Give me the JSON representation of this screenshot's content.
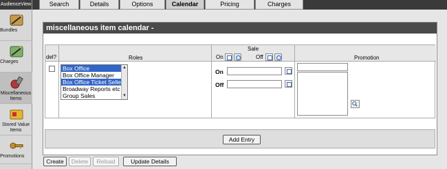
{
  "app": {
    "brand": "AudienceView"
  },
  "sidebar": {
    "items": [
      {
        "label": "Bundles",
        "icon": "bundles-icon"
      },
      {
        "label": "Charges",
        "icon": "charges-icon"
      },
      {
        "label": "Miscellaneous Items",
        "icon": "misc-items-icon",
        "active": true
      },
      {
        "label": "Stored Value Items",
        "icon": "stored-value-icon"
      },
      {
        "label": "Promotions",
        "icon": "promotions-icon"
      }
    ]
  },
  "tabs": [
    {
      "label": "Search"
    },
    {
      "label": "Details"
    },
    {
      "label": "Options"
    },
    {
      "label": "Calendar",
      "active": true
    },
    {
      "label": "Pricing"
    },
    {
      "label": "Charges"
    }
  ],
  "panel": {
    "title": "miscellaneous item calendar -",
    "headers": {
      "del": "del?",
      "roles": "Roles",
      "sale": "Sale",
      "sale_on": "On",
      "sale_off": "Off",
      "promotion": "Promotion"
    },
    "roles_options": [
      {
        "label": "Box Office",
        "selected": true
      },
      {
        "label": "Box Office Manager",
        "selected": false
      },
      {
        "label": "Box Office Ticket Seller",
        "selected": true
      },
      {
        "label": "Broadway Reports etc",
        "selected": false
      },
      {
        "label": "Group Sales",
        "selected": false
      }
    ],
    "sale_on_label": "On",
    "sale_off_label": "Off",
    "sale_on_value": "",
    "sale_off_value": "",
    "promotion_value": "",
    "add_entry_label": "Add Entry"
  },
  "actions": {
    "create": "Create",
    "delete": "Delete",
    "reload": "Reload",
    "update": "Update Details"
  },
  "colors": {
    "title_bar": "#4a4a4a",
    "tab_strip": "#3a3a3a",
    "selection": "#3165c7"
  }
}
